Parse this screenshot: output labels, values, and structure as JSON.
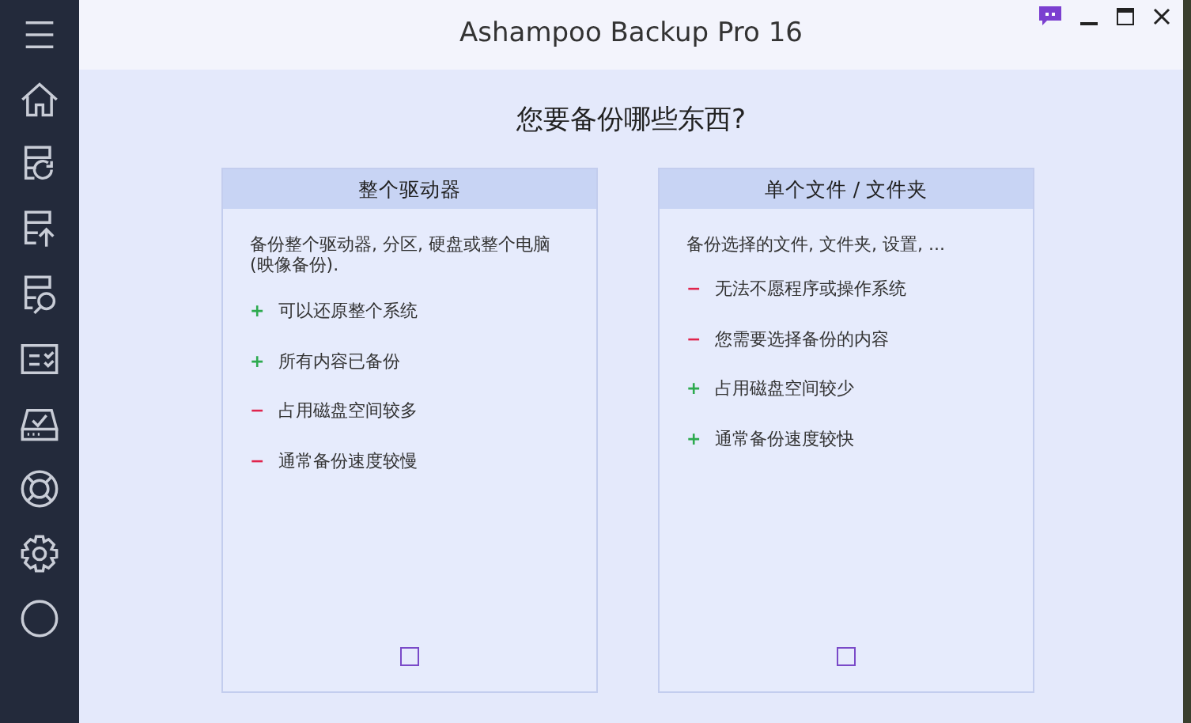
{
  "window": {
    "title": "Ashampoo Backup Pro 16"
  },
  "heading": "您要备份哪些东西?",
  "options": [
    {
      "title": "整个驱动器",
      "description": "备份整个驱动器, 分区, 硬盘或整个电脑 (映像备份).",
      "checked": false,
      "points": [
        {
          "kind": "pro",
          "sign": "+",
          "text": "可以还原整个系统"
        },
        {
          "kind": "pro",
          "sign": "+",
          "text": "所有内容已备份"
        },
        {
          "kind": "con",
          "sign": "−",
          "text": "占用磁盘空间较多"
        },
        {
          "kind": "con",
          "sign": "−",
          "text": "通常备份速度较慢"
        }
      ]
    },
    {
      "title": "单个文件 / 文件夹",
      "description": "备份选择的文件, 文件夹, 设置, ...",
      "checked": false,
      "points": [
        {
          "kind": "con",
          "sign": "−",
          "text": "无法不愿程序或操作系统"
        },
        {
          "kind": "con",
          "sign": "−",
          "text": "您需要选择备份的内容"
        },
        {
          "kind": "pro",
          "sign": "+",
          "text": "占用磁盘空间较少"
        },
        {
          "kind": "pro",
          "sign": "+",
          "text": "通常备份速度较快"
        }
      ]
    }
  ]
}
